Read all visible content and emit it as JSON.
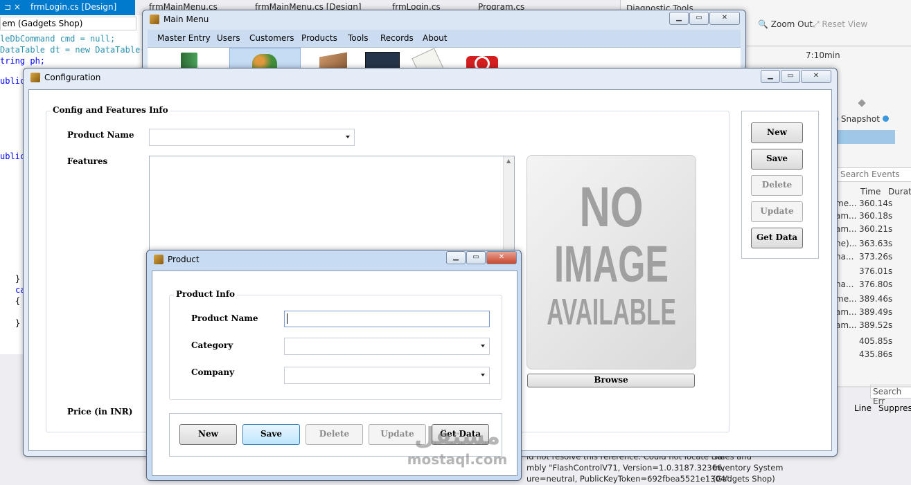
{
  "vs": {
    "tabs": [
      "frmLogin.cs [Design]",
      "frmMainMenu.cs",
      "frmMainMenu.cs [Design]",
      "frmLogin.cs",
      "Program.cs"
    ],
    "active_tab_pin": "⊐ ×",
    "member_combo": "em (Gadgets Shop)",
    "code_lines": [
      "leDbCommand cmd = null;",
      "DataTable dt = new DataTable()",
      "tring ph;",
      "ublic",
      "ublic",
      "}",
      "ca",
      "{",
      "}"
    ],
    "diag_title": "Diagnostic Tools",
    "zoom_out": "Zoom Out",
    "reset_view": "Reset View",
    "timeline_label": "7:10min",
    "snapshot": "Snapshot",
    "search_events": "Search Events",
    "col_time": "Time",
    "col_duration": "Durati",
    "event_times": [
      "360.14s",
      "360.18s",
      "360.21s",
      "363.63s",
      "373.26s",
      "376.01s",
      "376.80s",
      "389.46s",
      "389.49s",
      "389.52s",
      "405.85s",
      "435.86s"
    ],
    "event_names": [
      "me...",
      "am...",
      "am...",
      "ne)...",
      "na...",
      "",
      "na...",
      "me...",
      "am...",
      "am...",
      "",
      ""
    ],
    "search_errors": "Search Err",
    "col_line": "Line",
    "col_suppress": "Suppress",
    "error_text": "ld not resolve this reference. Could not locate the\nmbly \"FlashControlV71, Version=1.0.3187.32366,\nure=neutral, PublicKeyToken=692fbea5521e1304\".",
    "error_project": "Sales and\nInventory System\n(Gadgets Shop)"
  },
  "main_menu": {
    "title": "Main Menu",
    "menu": [
      "Master Entry",
      "Users",
      "Customers",
      "Products",
      "Tools",
      "Records",
      "About"
    ]
  },
  "configuration": {
    "title": "Configuration",
    "group_label": "Config and Features Info",
    "product_name_label": "Product Name",
    "features_label": "Features",
    "price_label": "Price (in INR)",
    "image_text": [
      "NO",
      "IMAGE",
      "AVAILABLE"
    ],
    "browse": "Browse",
    "buttons": {
      "new": "New",
      "save": "Save",
      "delete": "Delete",
      "update": "Update",
      "get_data": "Get Data"
    }
  },
  "product": {
    "title": "Product",
    "group_label": "Product Info",
    "product_name_label": "Product Name",
    "category_label": "Category",
    "company_label": "Company",
    "product_name_value": "",
    "buttons": {
      "new": "New",
      "save": "Save",
      "delete": "Delete",
      "update": "Update",
      "get_data": "Get Data"
    }
  },
  "watermark": {
    "line1": "مستقل",
    "line2": "mostaql.com"
  }
}
